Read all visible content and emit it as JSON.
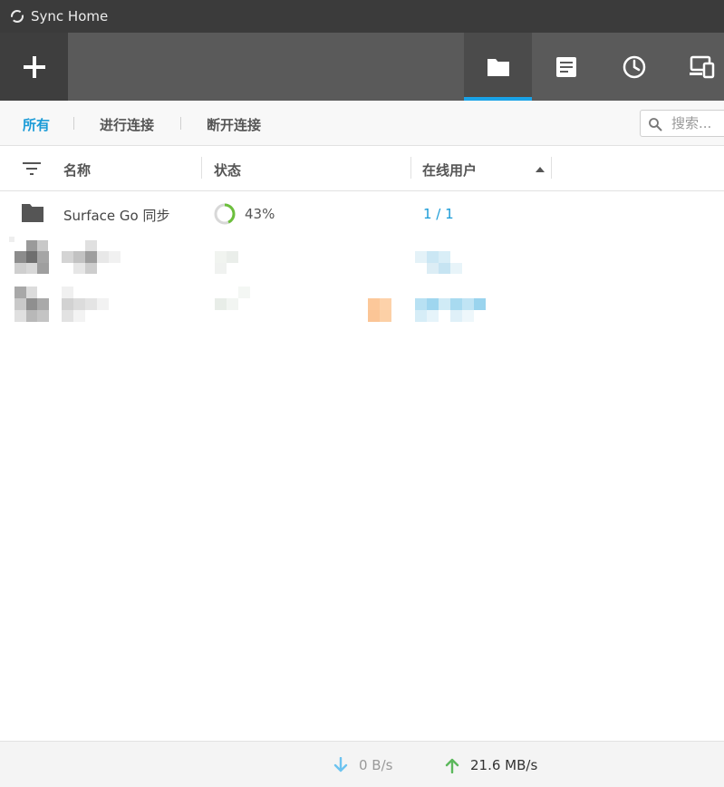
{
  "window": {
    "title": "Sync Home",
    "app_icon": "sync-icon"
  },
  "toolbar": {
    "add_icon": "plus-icon",
    "nav": [
      {
        "name": "folders",
        "icon": "folder-icon",
        "active": true
      },
      {
        "name": "notes",
        "icon": "notes-icon",
        "active": false
      },
      {
        "name": "history",
        "icon": "clock-icon",
        "active": false
      },
      {
        "name": "devices",
        "icon": "devices-icon",
        "active": false
      }
    ],
    "accent": "#1aa3e8"
  },
  "filters": {
    "all": "所有",
    "connecting": "进行连接",
    "disconnected": "断开连接"
  },
  "search": {
    "placeholder": "搜索..."
  },
  "table": {
    "columns": {
      "name": "名称",
      "status": "状态",
      "online_users": "在线用户"
    },
    "rows": [
      {
        "name": "Surface Go 同步",
        "status": "43%",
        "progress": 0.43,
        "online_users": "1 / 1"
      }
    ]
  },
  "footer": {
    "download_rate": "0 B/s",
    "upload_rate": "21.6 MB/s",
    "download_color": "#6cc3f0",
    "upload_color": "#5cb85c"
  }
}
